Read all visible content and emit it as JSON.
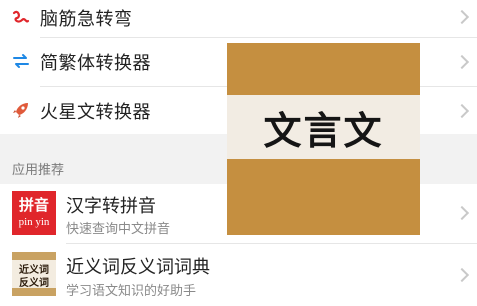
{
  "tools": [
    {
      "label": "脑筋急转弯",
      "icon": "squiggle-icon",
      "color": "#e0262b"
    },
    {
      "label": "简繁体转换器",
      "icon": "swap-arrows-icon",
      "color": "#1e88e5"
    },
    {
      "label": "火星文转换器",
      "icon": "rocket-icon",
      "color": "#e05a3a"
    }
  ],
  "section_title": "应用推荐",
  "apps": [
    {
      "title": "汉字转拼音",
      "subtitle": "快速查询中文拼音",
      "thumb_line1": "拼音",
      "thumb_line2": "pin yin"
    },
    {
      "title": "近义词反义词词典",
      "subtitle": "学习语文知识的好助手",
      "thumb_line1": "近义词",
      "thumb_line2": "反义词"
    }
  ],
  "overlay": {
    "text": "文言文"
  },
  "colors": {
    "accent_red": "#e0262b",
    "accent_blue": "#1e88e5",
    "overlay_bg": "#c58f40"
  }
}
